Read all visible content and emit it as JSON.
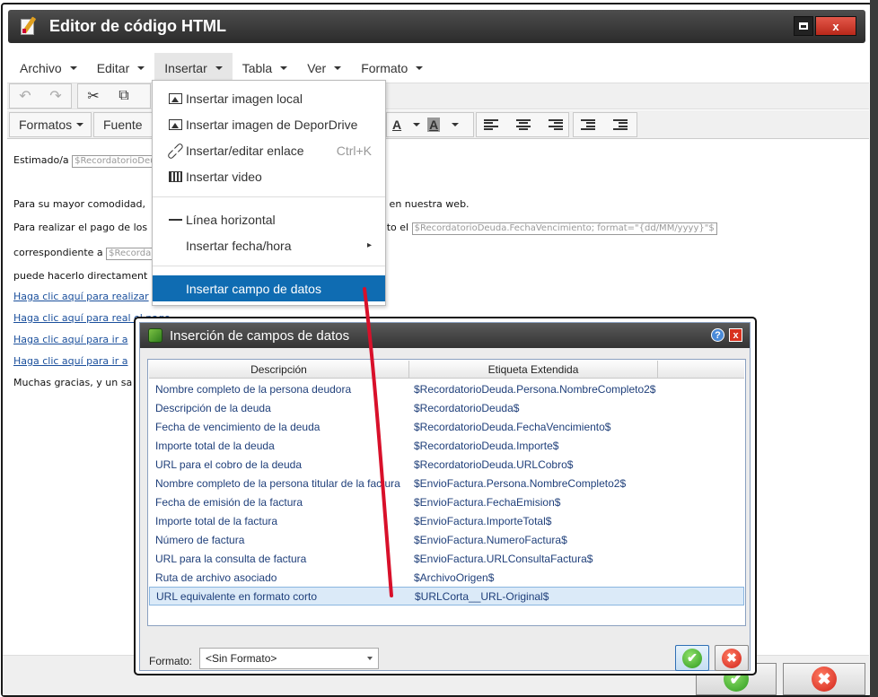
{
  "window": {
    "title": "Editor de código HTML",
    "close_glyph": "x"
  },
  "menubar": [
    {
      "label": "Archivo"
    },
    {
      "label": "Editar"
    },
    {
      "label": "Insertar"
    },
    {
      "label": "Tabla"
    },
    {
      "label": "Ver"
    },
    {
      "label": "Formato"
    }
  ],
  "toolbar": {
    "formats_label": "Formatos",
    "font_label": "Fuente",
    "undo_icon": "↶",
    "redo_icon": "↷",
    "cut_icon": "✂",
    "copy_icon": "⧉",
    "text_color": "A",
    "bg_color": "A"
  },
  "content": {
    "lines": [
      {
        "pre": "Estimado/a ",
        "token": "$RecordatorioDeu"
      },
      {
        "pre": "Para su mayor comodidad, ",
        "post": "nte en nuestra web."
      },
      {
        "pre": "Para realizar el pago de los",
        "mid": "ento el ",
        "token": "$RecordatorioDeuda.FechaVencimiento; format=\"{dd/MM/yyyy}\"$"
      },
      {
        "pre": "correspondiente a ",
        "token": "$Recorda"
      },
      {
        "pre": "puede hacerlo directament"
      },
      {
        "link": "Haga clic aquí para realizar"
      },
      {
        "link": "Haga clic aquí para rea",
        "tail": "l el pago."
      },
      {
        "link": "Haga clic aquí para ir a"
      },
      {
        "link": "Haga clic aquí para ir a"
      },
      {
        "pre": "Muchas gracias, y un sa"
      }
    ]
  },
  "insert_menu": {
    "items": [
      {
        "label": "Insertar imagen local",
        "icon": "image-icon"
      },
      {
        "label": "Insertar imagen de DeporDrive",
        "icon": "image-icon"
      },
      {
        "label": "Insertar/editar enlace",
        "shortcut": "Ctrl+K",
        "icon": "link-icon"
      },
      {
        "label": "Insertar video",
        "icon": "film-icon"
      },
      {
        "label": "Línea horizontal",
        "icon": "hr-icon"
      },
      {
        "label": "Insertar fecha/hora",
        "submenu": "▸"
      },
      {
        "label": "Insertar campo de datos"
      }
    ]
  },
  "dialog": {
    "title": "Inserción de campos de datos",
    "help": "?",
    "close": "x",
    "columns": [
      "Descripción",
      "Etiqueta Extendida"
    ],
    "rows": [
      [
        "Nombre completo de la persona deudora",
        "$RecordatorioDeuda.Persona.NombreCompleto2$"
      ],
      [
        "Descripción de la deuda",
        "$RecordatorioDeuda$"
      ],
      [
        "Fecha de vencimiento de la deuda",
        "$RecordatorioDeuda.FechaVencimiento$"
      ],
      [
        "Importe total de la deuda",
        "$RecordatorioDeuda.Importe$"
      ],
      [
        "URL para el cobro de la deuda",
        "$RecordatorioDeuda.URLCobro$"
      ],
      [
        "Nombre completo de la persona titular de la factura",
        "$EnvioFactura.Persona.NombreCompleto2$"
      ],
      [
        "Fecha de emisión de la factura",
        "$EnvioFactura.FechaEmision$"
      ],
      [
        "Importe total de la factura",
        "$EnvioFactura.ImporteTotal$"
      ],
      [
        "Número de factura",
        "$EnvioFactura.NumeroFactura$"
      ],
      [
        "URL para la consulta de factura",
        "$EnvioFactura.URLConsultaFactura$"
      ],
      [
        "Ruta de archivo asociado",
        "$ArchivoOrigen$"
      ],
      [
        "URL equivalente en formato corto",
        "$URLCorta__URL-Original$"
      ]
    ],
    "selected_row": 11,
    "format_label": "Formato:",
    "format_value": "<Sin Formato>",
    "ok_glyph": "✔",
    "cancel_glyph": "✖"
  },
  "colors": {
    "menu_highlight": "#0f6cb2",
    "annotation": "#d8102a"
  }
}
